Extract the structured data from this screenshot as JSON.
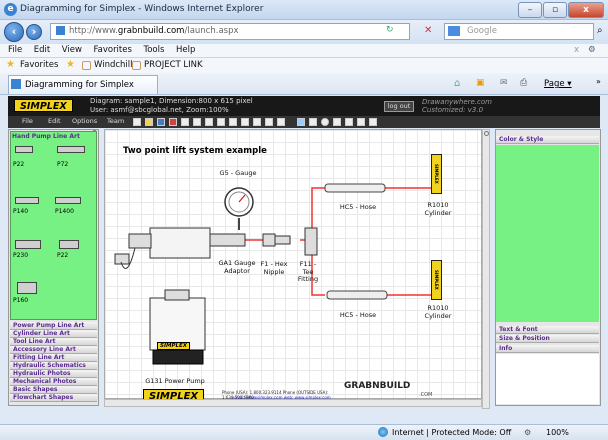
{
  "window": {
    "title": "Diagramming for Simplex - Windows Internet Explorer",
    "buttons": [
      "–",
      "▫",
      "x"
    ]
  },
  "address": {
    "url_prefix": "http://www.",
    "url_domain": "grabnbuild.com",
    "url_path": "/launch.aspx",
    "search_placeholder": "Google"
  },
  "menu": {
    "items": [
      "File",
      "Edit",
      "View",
      "Favorites",
      "Tools",
      "Help"
    ]
  },
  "favorites": {
    "label": "Favorites",
    "links": [
      "Windchill",
      "PROJECT LINK"
    ]
  },
  "tab": {
    "label": "Diagramming for Simplex",
    "page_menu": "Page ▾"
  },
  "app": {
    "logo": "SIMPLEX",
    "diagram_info_line1": "Diagram: sample1, Dimension:800 x 615 pixel",
    "diagram_info_line2": "User: asmf@sbcglobal.net, Zoom:100%",
    "logout": "log out",
    "brand_line1": "Drawanywhere.com",
    "brand_line2": "Customized: v3.0",
    "menus": [
      "File",
      "Edit",
      "Options",
      "Team"
    ]
  },
  "left_panel": {
    "current": "Hand Pump Line Art",
    "parts": [
      "P22",
      "P72",
      "P140",
      "P1400",
      "P230",
      "P22",
      "P160"
    ],
    "categories": [
      "Power Pump Line Art",
      "Cylinder Line Art",
      "Tool Line Art",
      "Accessory Line Art",
      "Fitting Line Art",
      "Hydraulic Schematics",
      "Hydraulic Photos",
      "Mechanical Photos",
      "Basic Shapes",
      "Flowchart Shapes"
    ]
  },
  "diagram": {
    "title": "Two point lift system example",
    "labels": {
      "gauge": "G5 - Gauge",
      "adaptor": "GA1 Gauge Adaptor",
      "nipple": "F1 - Hex Nipple",
      "tee": "F11 - Tee Fitting",
      "hose_top": "HC5 - Hose",
      "hose_bottom": "HC5 - Hose",
      "cyl_top": "R1010 Cylinder",
      "cyl_bottom": "R1010 Cylinder",
      "pump": "G131 Power Pump",
      "pump_badge": "SIMPLEX",
      "cyl_badge": "SIMPLEX"
    },
    "footer_logo": "SIMPLEX",
    "phone_line": "Phone (USA): 1.800.323.9114  Phone (OUTSIDE USA): 1.630.590.6900",
    "email_line": "email: info@simplex.com  web: www.simplex.com",
    "right_logo": "GRABNBUILD",
    "right_logo_sub": ".COM"
  },
  "right_panel": {
    "sections": [
      "Color & Style",
      "Text & Font",
      "Size & Position",
      "Info"
    ]
  },
  "status": {
    "zone": "Internet | Protected Mode: Off",
    "zoom": "100%"
  }
}
